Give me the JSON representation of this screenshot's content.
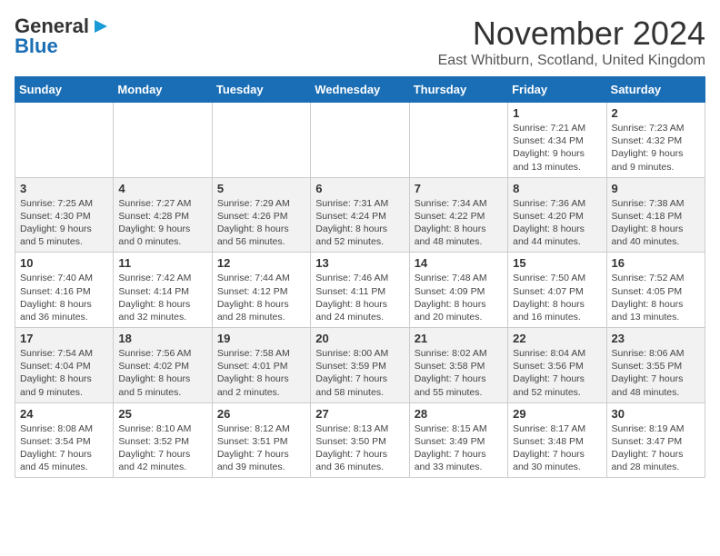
{
  "header": {
    "logo_line1": "General",
    "logo_line2": "Blue",
    "month_title": "November 2024",
    "location": "East Whitburn, Scotland, United Kingdom"
  },
  "weekdays": [
    "Sunday",
    "Monday",
    "Tuesday",
    "Wednesday",
    "Thursday",
    "Friday",
    "Saturday"
  ],
  "weeks": [
    [
      {
        "day": "",
        "info": ""
      },
      {
        "day": "",
        "info": ""
      },
      {
        "day": "",
        "info": ""
      },
      {
        "day": "",
        "info": ""
      },
      {
        "day": "",
        "info": ""
      },
      {
        "day": "1",
        "info": "Sunrise: 7:21 AM\nSunset: 4:34 PM\nDaylight: 9 hours and 13 minutes."
      },
      {
        "day": "2",
        "info": "Sunrise: 7:23 AM\nSunset: 4:32 PM\nDaylight: 9 hours and 9 minutes."
      }
    ],
    [
      {
        "day": "3",
        "info": "Sunrise: 7:25 AM\nSunset: 4:30 PM\nDaylight: 9 hours and 5 minutes."
      },
      {
        "day": "4",
        "info": "Sunrise: 7:27 AM\nSunset: 4:28 PM\nDaylight: 9 hours and 0 minutes."
      },
      {
        "day": "5",
        "info": "Sunrise: 7:29 AM\nSunset: 4:26 PM\nDaylight: 8 hours and 56 minutes."
      },
      {
        "day": "6",
        "info": "Sunrise: 7:31 AM\nSunset: 4:24 PM\nDaylight: 8 hours and 52 minutes."
      },
      {
        "day": "7",
        "info": "Sunrise: 7:34 AM\nSunset: 4:22 PM\nDaylight: 8 hours and 48 minutes."
      },
      {
        "day": "8",
        "info": "Sunrise: 7:36 AM\nSunset: 4:20 PM\nDaylight: 8 hours and 44 minutes."
      },
      {
        "day": "9",
        "info": "Sunrise: 7:38 AM\nSunset: 4:18 PM\nDaylight: 8 hours and 40 minutes."
      }
    ],
    [
      {
        "day": "10",
        "info": "Sunrise: 7:40 AM\nSunset: 4:16 PM\nDaylight: 8 hours and 36 minutes."
      },
      {
        "day": "11",
        "info": "Sunrise: 7:42 AM\nSunset: 4:14 PM\nDaylight: 8 hours and 32 minutes."
      },
      {
        "day": "12",
        "info": "Sunrise: 7:44 AM\nSunset: 4:12 PM\nDaylight: 8 hours and 28 minutes."
      },
      {
        "day": "13",
        "info": "Sunrise: 7:46 AM\nSunset: 4:11 PM\nDaylight: 8 hours and 24 minutes."
      },
      {
        "day": "14",
        "info": "Sunrise: 7:48 AM\nSunset: 4:09 PM\nDaylight: 8 hours and 20 minutes."
      },
      {
        "day": "15",
        "info": "Sunrise: 7:50 AM\nSunset: 4:07 PM\nDaylight: 8 hours and 16 minutes."
      },
      {
        "day": "16",
        "info": "Sunrise: 7:52 AM\nSunset: 4:05 PM\nDaylight: 8 hours and 13 minutes."
      }
    ],
    [
      {
        "day": "17",
        "info": "Sunrise: 7:54 AM\nSunset: 4:04 PM\nDaylight: 8 hours and 9 minutes."
      },
      {
        "day": "18",
        "info": "Sunrise: 7:56 AM\nSunset: 4:02 PM\nDaylight: 8 hours and 5 minutes."
      },
      {
        "day": "19",
        "info": "Sunrise: 7:58 AM\nSunset: 4:01 PM\nDaylight: 8 hours and 2 minutes."
      },
      {
        "day": "20",
        "info": "Sunrise: 8:00 AM\nSunset: 3:59 PM\nDaylight: 7 hours and 58 minutes."
      },
      {
        "day": "21",
        "info": "Sunrise: 8:02 AM\nSunset: 3:58 PM\nDaylight: 7 hours and 55 minutes."
      },
      {
        "day": "22",
        "info": "Sunrise: 8:04 AM\nSunset: 3:56 PM\nDaylight: 7 hours and 52 minutes."
      },
      {
        "day": "23",
        "info": "Sunrise: 8:06 AM\nSunset: 3:55 PM\nDaylight: 7 hours and 48 minutes."
      }
    ],
    [
      {
        "day": "24",
        "info": "Sunrise: 8:08 AM\nSunset: 3:54 PM\nDaylight: 7 hours and 45 minutes."
      },
      {
        "day": "25",
        "info": "Sunrise: 8:10 AM\nSunset: 3:52 PM\nDaylight: 7 hours and 42 minutes."
      },
      {
        "day": "26",
        "info": "Sunrise: 8:12 AM\nSunset: 3:51 PM\nDaylight: 7 hours and 39 minutes."
      },
      {
        "day": "27",
        "info": "Sunrise: 8:13 AM\nSunset: 3:50 PM\nDaylight: 7 hours and 36 minutes."
      },
      {
        "day": "28",
        "info": "Sunrise: 8:15 AM\nSunset: 3:49 PM\nDaylight: 7 hours and 33 minutes."
      },
      {
        "day": "29",
        "info": "Sunrise: 8:17 AM\nSunset: 3:48 PM\nDaylight: 7 hours and 30 minutes."
      },
      {
        "day": "30",
        "info": "Sunrise: 8:19 AM\nSunset: 3:47 PM\nDaylight: 7 hours and 28 minutes."
      }
    ]
  ]
}
